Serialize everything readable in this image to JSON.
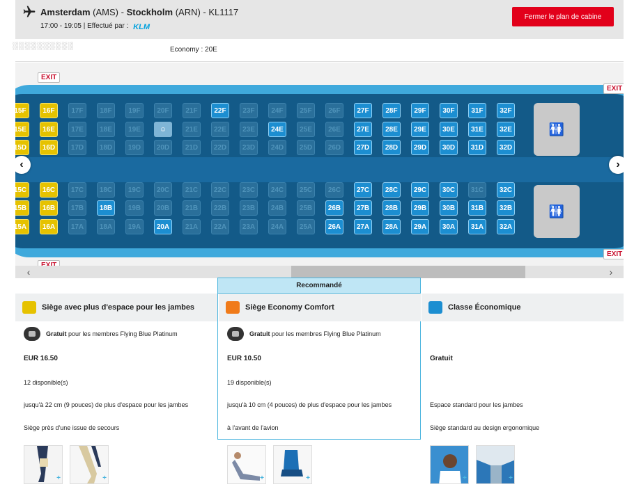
{
  "header": {
    "origin_city": "Amsterdam",
    "origin_code": "(AMS)",
    "separator": "-",
    "dest_city": "Stockholm",
    "dest_code": "(ARN)",
    "flight": "- KL1117",
    "times": "17:00 - 19:05 | Effectué par :",
    "airline_logo": "KLM",
    "close_label": "Fermer le plan de cabine"
  },
  "passenger": {
    "name": "░░░░░░░░░░",
    "seat_class": "Economy : 20E"
  },
  "cabin": {
    "exit_label": "EXIT",
    "lavatory_icon": "restroom-icon",
    "rows": [
      "15",
      "16",
      "17",
      "18",
      "19",
      "20",
      "21",
      "22",
      "23",
      "24",
      "25",
      "26",
      "27",
      "28",
      "29",
      "30",
      "31",
      "32"
    ],
    "colors": {
      "available": "#1c8ed1",
      "extra_legroom": "#e6c200",
      "comfort": "#f07b1a",
      "shell": "#3fa9dc",
      "cabin": "#135a88"
    }
  },
  "panels": {
    "recommended_label": "Recommandé",
    "items": [
      {
        "title": "Siège avec plus d'espace pour les jambes",
        "icon_color": "#e6c200",
        "fb_bold": "Gratuit",
        "fb_text": "pour les membres Flying Blue Platinum",
        "price": "EUR 16.50",
        "available": "12 disponible(s)",
        "feature1": "jusqu'à 22 cm (9 pouces) de plus d'espace pour les jambes",
        "feature2": "Siège près d'une issue de secours"
      },
      {
        "title": "Siège Economy Comfort",
        "icon_color": "#f07b1a",
        "fb_bold": "Gratuit",
        "fb_text": "pour les membres Flying Blue Platinum",
        "price": "EUR 10.50",
        "available": "19 disponible(s)",
        "feature1": "jusqu'à 10 cm (4 pouces) de plus d'espace pour les jambes",
        "feature2": "à l'avant de l'avion"
      },
      {
        "title": "Classe Économique",
        "icon_color": "#1c8ed1",
        "price": "Gratuit",
        "feature1": "Espace standard pour les jambes",
        "feature2": "Siège standard au design ergonomique"
      }
    ]
  }
}
